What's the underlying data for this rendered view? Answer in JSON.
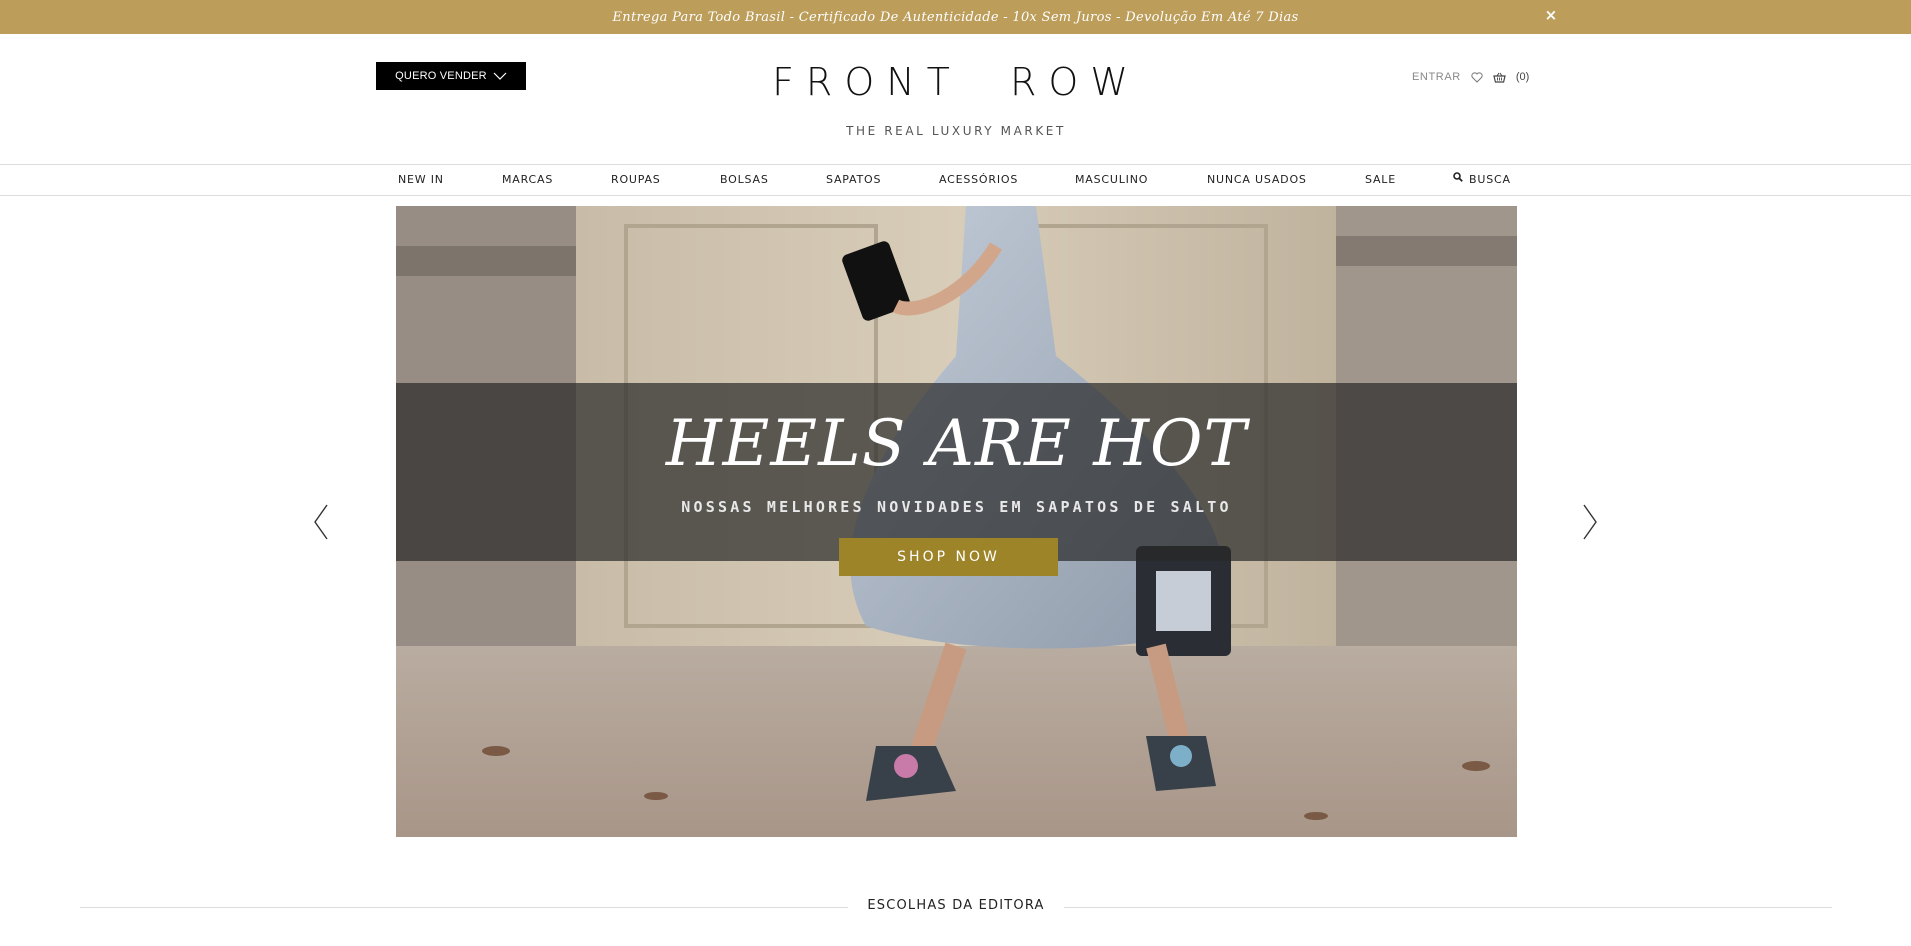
{
  "promo_bar": {
    "text": "Entrega Para Todo Brasil - Certificado De Autenticidade - 10x Sem Juros - Devolução Em Até 7 Dias",
    "close_label": "×",
    "background": "#bc9d5a"
  },
  "header": {
    "sell_button_label": "QUERO VENDER",
    "logo": "FRONT  ROW",
    "tagline": "THE REAL LUXURY MARKET",
    "login_label": "ENTRAR",
    "wishlist_icon": "heart-icon",
    "cart_icon": "basket-icon",
    "cart_count": "(0)"
  },
  "nav": {
    "items": [
      {
        "label": "NEW IN"
      },
      {
        "label": "MARCAS"
      },
      {
        "label": "ROUPAS"
      },
      {
        "label": "BOLSAS"
      },
      {
        "label": "SAPATOS"
      },
      {
        "label": "ACESSÓRIOS"
      },
      {
        "label": "MASCULINO"
      },
      {
        "label": "NUNCA USADOS"
      },
      {
        "label": "SALE"
      },
      {
        "label": "BUSCA",
        "icon": "search-icon"
      }
    ]
  },
  "hero": {
    "title": "HEELS ARE HOT",
    "subtitle": "NOSSAS MELHORES NOVIDADES EM SAPATOS DE SALTO",
    "cta_label": "SHOP NOW",
    "cta_color": "#9e8429",
    "prev_icon": "chevron-left-icon",
    "next_icon": "chevron-right-icon"
  },
  "sections": {
    "editors_picks_title": "ESCOLHAS DA EDITORA"
  }
}
